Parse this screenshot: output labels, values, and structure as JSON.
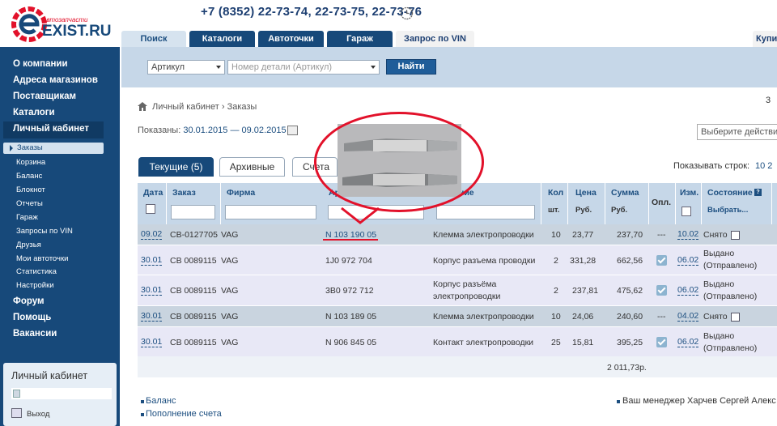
{
  "header": {
    "logo_sub": "Автозапчасти",
    "logo_main": "EXIST.RU",
    "phone": "+7 (8352) 22-73-74, 22-73-75, 22-73-76",
    "nav_tabs": [
      {
        "label": "Поиск"
      },
      {
        "label": "Каталоги"
      },
      {
        "label": "Автоточки"
      },
      {
        "label": "Гараж"
      },
      {
        "label": "Запрос по VIN"
      },
      {
        "label": "Купит"
      }
    ]
  },
  "search": {
    "type_value": "Артикул",
    "placeholder": "Номер детали (Артикул)",
    "button": "Найти"
  },
  "sidebar": {
    "main_items": [
      {
        "label": "О компании"
      },
      {
        "label": "Адреса магазинов"
      },
      {
        "label": "Поставщикам"
      },
      {
        "label": "Каталоги"
      },
      {
        "label": "Личный кабинет"
      }
    ],
    "sub_items": [
      {
        "label": "Заказы"
      },
      {
        "label": "Корзина"
      },
      {
        "label": "Баланс"
      },
      {
        "label": "Блокнот"
      },
      {
        "label": "Отчеты"
      },
      {
        "label": "Гараж"
      },
      {
        "label": "Запросы по VIN"
      },
      {
        "label": "Друзья"
      },
      {
        "label": "Мои автоточки"
      },
      {
        "label": "Статистика"
      },
      {
        "label": "Настройки"
      }
    ],
    "bottom_items": [
      {
        "label": "Форум"
      },
      {
        "label": "Помощь"
      },
      {
        "label": "Вакансии"
      }
    ],
    "box_title": "Личный кабинет",
    "logout": "Выход"
  },
  "main": {
    "breadcrumb_1": "Личный кабинет",
    "breadcrumb_sep": "›",
    "breadcrumb_2": "Заказы",
    "shown_label": "Показаны:",
    "shown_range": "30.01.2015 — 09.02.2015",
    "choose_action": "Выберите действи",
    "right_num": "3",
    "tabs": [
      {
        "label": "Текущие (5)"
      },
      {
        "label": "Архивные"
      },
      {
        "label": "Счета"
      }
    ],
    "rows_label": "Показывать строк:",
    "rows_options": "10  2"
  },
  "table": {
    "headers": {
      "date": "Дата",
      "order": "Заказ",
      "firm": "Фирма",
      "article": "Ар",
      "name": "ние",
      "qty": "Кол",
      "qty_unit": "шт.",
      "price": "Цена",
      "price_unit": "Руб.",
      "sum": "Сумма",
      "sum_unit": "Руб.",
      "paid": "Опл.",
      "changed": "Изм.",
      "status": "Состояние",
      "status_select": "Выбрать..."
    },
    "rows": [
      {
        "date": "09.02",
        "order": "СВ-0127705",
        "firm": "VAG",
        "article": "N 103 190 05",
        "name": "Клемма электропроводки",
        "name2": "",
        "qty": "10",
        "price": "23,77",
        "sum": "237,70",
        "paid": "---",
        "changed": "10.02",
        "status": "Снято",
        "status2": ""
      },
      {
        "date": "30.01",
        "order": "СВ 0089115",
        "firm": "VAG",
        "article": "1J0 972 704",
        "name": "Корпус разъема проводки",
        "name2": "",
        "qty": "2",
        "price": "331,28",
        "sum": "662,56",
        "paid": "",
        "changed": "06.02",
        "status": "Выдано",
        "status2": "(Отправлено)"
      },
      {
        "date": "30.01",
        "order": "СВ 0089115",
        "firm": "VAG",
        "article": "3B0 972 712",
        "name": "Корпус разъёма",
        "name2": "электропроводки",
        "qty": "2",
        "price": "237,81",
        "sum": "475,62",
        "paid": "",
        "changed": "06.02",
        "status": "Выдано",
        "status2": "(Отправлено)"
      },
      {
        "date": "30.01",
        "order": "СВ 0089115",
        "firm": "VAG",
        "article": "N 103 189 05",
        "name": "Клемма электропроводки",
        "name2": "",
        "qty": "10",
        "price": "24,06",
        "sum": "240,60",
        "paid": "---",
        "changed": "04.02",
        "status": "Снято",
        "status2": ""
      },
      {
        "date": "30.01",
        "order": "СВ 0089115",
        "firm": "VAG",
        "article": "N 906 845 05",
        "name": "Контакт электропроводки",
        "name2": "",
        "qty": "25",
        "price": "15,81",
        "sum": "395,25",
        "paid": "",
        "changed": "06.02",
        "status": "Выдано",
        "status2": "(Отправлено)"
      }
    ],
    "total": "2 011,73р."
  },
  "footer": {
    "balance": "Баланс",
    "topup": "Пополнение счета",
    "manager": "Ваш менеджер Харчев Сергей Алекс"
  },
  "colors": {
    "brand_blue": "#17497a",
    "logo_red": "#e2112a",
    "annotation_red": "#e2112a"
  }
}
